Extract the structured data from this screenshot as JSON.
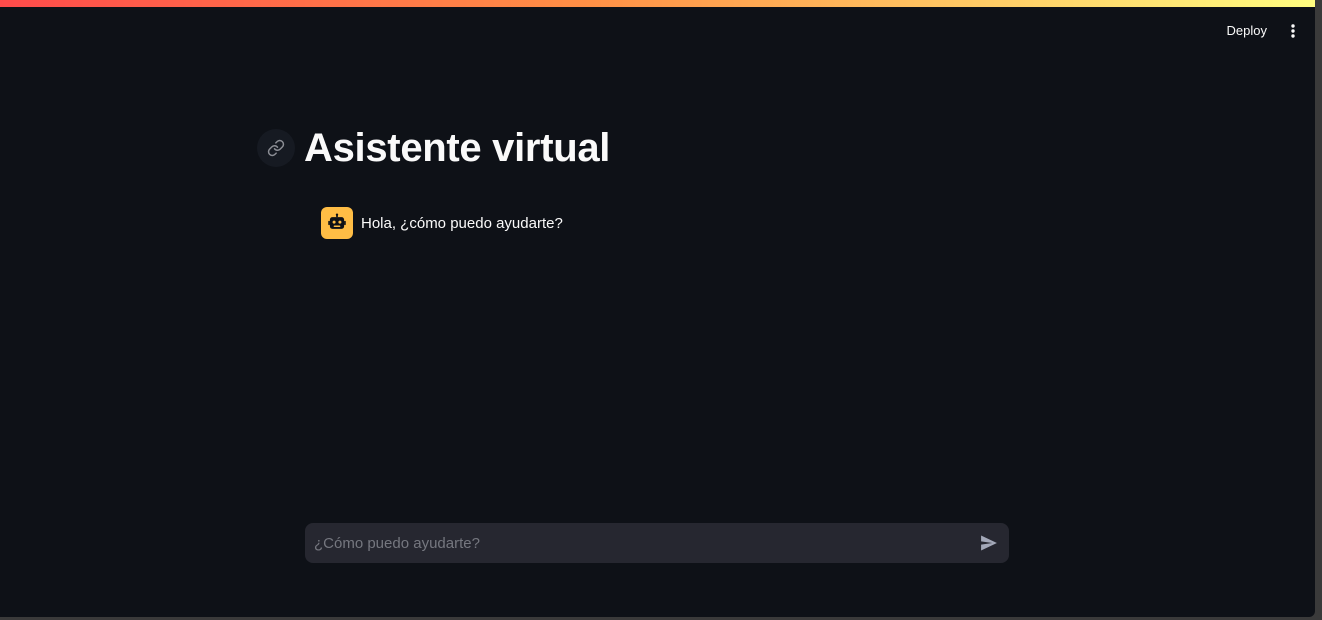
{
  "header": {
    "deploy_label": "Deploy",
    "menu_icon": "more-vertical-icon"
  },
  "main": {
    "title": "Asistente virtual",
    "anchor_icon": "link-icon"
  },
  "messages": [
    {
      "role": "assistant",
      "avatar_icon": "robot-icon",
      "text": "Hola, ¿cómo puedo ayudarte?"
    }
  ],
  "chat_input": {
    "placeholder": "¿Cómo puedo ayudarte?",
    "value": "",
    "send_icon": "send-icon"
  },
  "colors": {
    "background": "#0e1117",
    "text": "#fafafa",
    "avatar": "#ffbd45",
    "input_background": "#262730",
    "decoration_gradient": [
      "#ff4b4b",
      "#ff9046",
      "#fffd80"
    ]
  }
}
